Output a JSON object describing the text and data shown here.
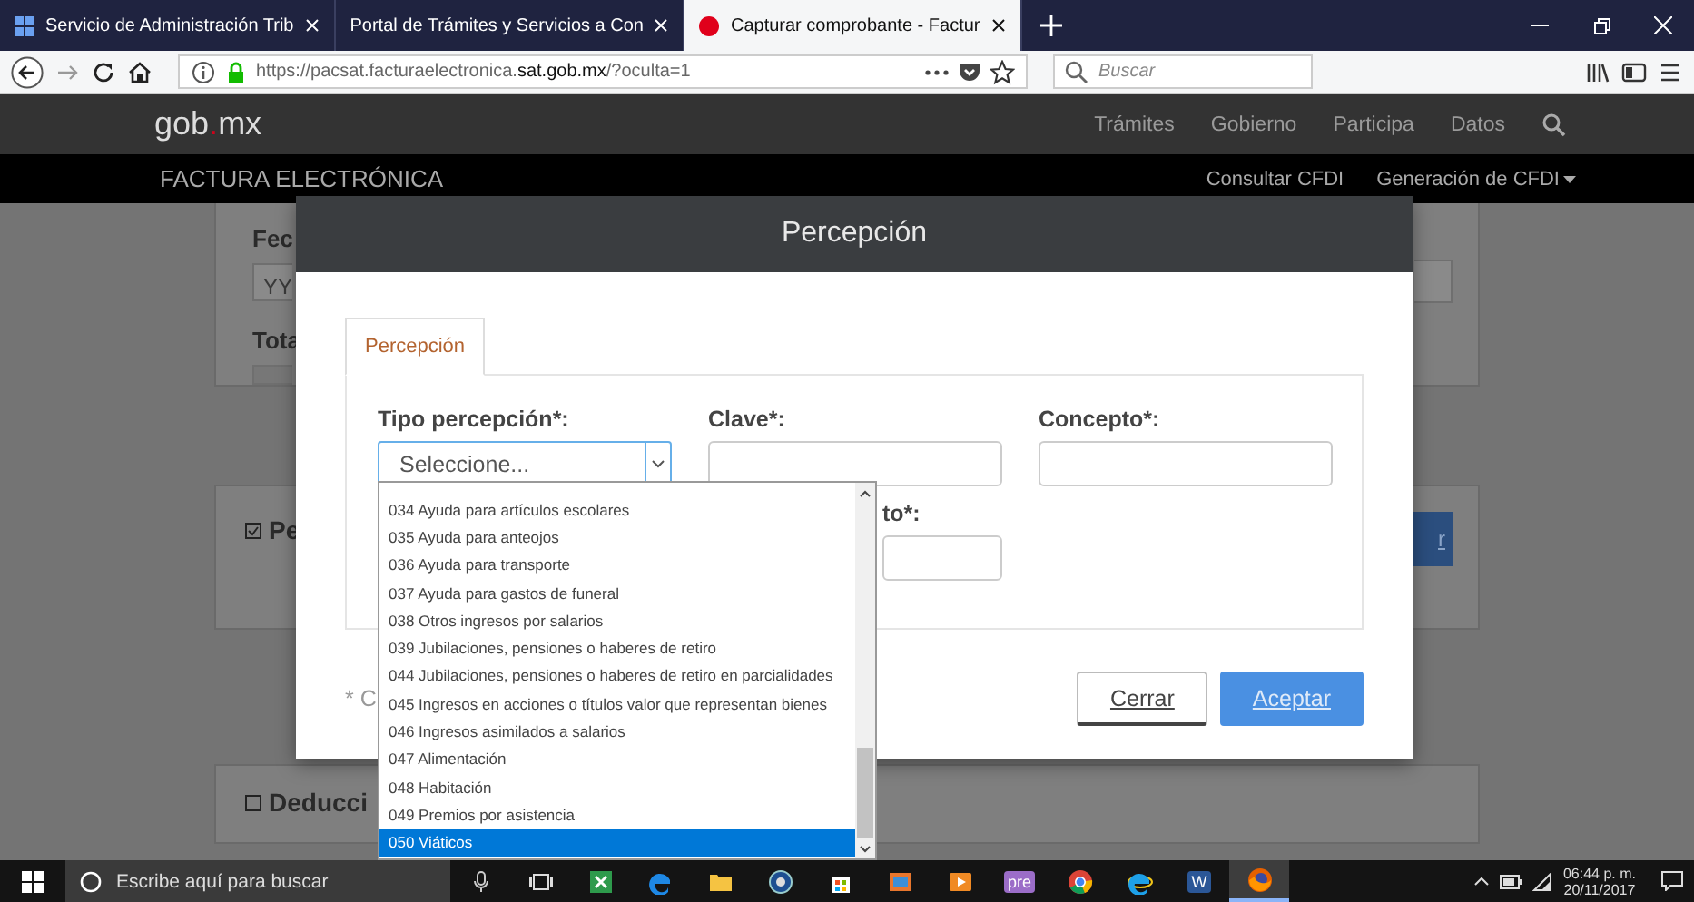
{
  "browser": {
    "tabs": [
      {
        "title": "Servicio de Administración Trib",
        "kind": "squares",
        "selected": false
      },
      {
        "title": "Portal de Trámites y Servicios a Con",
        "kind": "plain",
        "selected": false
      },
      {
        "title": "Capturar comprobante - Factur",
        "kind": "dot",
        "selected": true
      }
    ],
    "url": "https://pacsat.facturaelectronica.**sat.gob.mx**/?oculta=1",
    "search_placeholder": "Buscar"
  },
  "site": {
    "logo": [
      {
        "text": "gob",
        "accent": false
      },
      {
        "text": ".",
        "accent": true
      },
      {
        "text": "mx",
        "accent": false
      }
    ],
    "nav": [
      "Trámites",
      "Gobierno",
      "Participa",
      "Datos"
    ],
    "section_title": "FACTURA ELECTRÓNICA",
    "section_nav": [
      {
        "label": "Consultar CFDI",
        "dropdown": false
      },
      {
        "label": "Generación de CFDI",
        "dropdown": true
      }
    ]
  },
  "background": {
    "labels": [
      "Fec",
      "Tota"
    ],
    "date_placeholder": "YY",
    "panels": [
      {
        "label": "Pe",
        "checked": true
      },
      {
        "label": "Deducci",
        "checked": false
      }
    ],
    "button_label": "r"
  },
  "modal": {
    "title": "Percepción",
    "tabs": [
      {
        "label": "Percepción",
        "selected": true
      }
    ],
    "fields": [
      {
        "label": "Tipo percepción*:",
        "kind": "select",
        "value": "Seleccione..."
      },
      {
        "label": "Clave*:",
        "kind": "text"
      },
      {
        "label": "Concepto*:",
        "kind": "text"
      },
      {
        "label": "to*:",
        "kind": "text"
      }
    ],
    "note": "* C",
    "buttons": [
      {
        "label": "Cerrar",
        "kind": "secondary"
      },
      {
        "label": "Aceptar",
        "kind": "primary"
      }
    ]
  },
  "dropdown": {
    "options": [
      {
        "label": "034 Ayuda para artículos escolares",
        "selected": false
      },
      {
        "label": "035 Ayuda para anteojos",
        "selected": false
      },
      {
        "label": "036 Ayuda para transporte",
        "selected": false
      },
      {
        "label": "037 Ayuda para gastos de funeral",
        "selected": false
      },
      {
        "label": "038 Otros ingresos por salarios",
        "selected": false
      },
      {
        "label": "039 Jubilaciones, pensiones o haberes de retiro",
        "selected": false
      },
      {
        "label": "044 Jubilaciones, pensiones o haberes de retiro en parcialidades",
        "selected": false
      },
      {
        "label": "045 Ingresos en acciones o títulos valor que representan bienes",
        "selected": false
      },
      {
        "label": "046 Ingresos asimilados a salarios",
        "selected": false
      },
      {
        "label": "047 Alimentación",
        "selected": false
      },
      {
        "label": "048 Habitación",
        "selected": false
      },
      {
        "label": "049 Premios por asistencia",
        "selected": false
      },
      {
        "label": "050 Viáticos",
        "selected": true
      }
    ]
  },
  "taskbar": {
    "search_placeholder": "Escribe aquí para buscar",
    "apps": [
      {
        "kind": "taskview",
        "active": false
      },
      {
        "kind": "sheet",
        "active": false
      },
      {
        "kind": "edge",
        "active": false
      },
      {
        "kind": "folder",
        "active": false
      },
      {
        "kind": "hp",
        "active": false
      },
      {
        "kind": "store",
        "active": false
      },
      {
        "kind": "photos",
        "active": false
      },
      {
        "kind": "media",
        "active": false
      },
      {
        "kind": "pre",
        "label": "pre",
        "active": false
      },
      {
        "kind": "chrome",
        "active": false
      },
      {
        "kind": "ie",
        "active": false
      },
      {
        "kind": "word",
        "label": "W",
        "active": false
      },
      {
        "kind": "firefox",
        "active": true
      }
    ],
    "clock": {
      "time": "06:44 p. m.",
      "date": "20/11/2017"
    }
  }
}
